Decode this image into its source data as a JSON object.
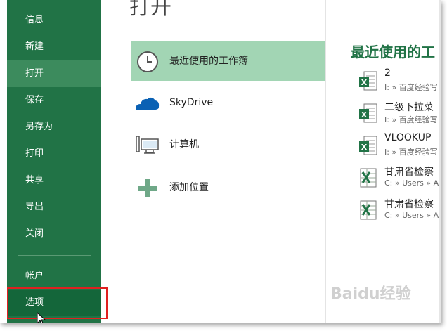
{
  "nav": {
    "items": [
      {
        "label": "信息"
      },
      {
        "label": "新建"
      },
      {
        "label": "打开"
      },
      {
        "label": "保存"
      },
      {
        "label": "另存为"
      },
      {
        "label": "打印"
      },
      {
        "label": "共享"
      },
      {
        "label": "导出"
      },
      {
        "label": "关闭"
      },
      {
        "label": "帐户"
      },
      {
        "label": "选项"
      }
    ]
  },
  "main": {
    "title": "打开",
    "places": [
      {
        "label": "最近使用的工作簿",
        "icon": "clock-icon"
      },
      {
        "label": "SkyDrive",
        "icon": "cloud-icon"
      },
      {
        "label": "计算机",
        "icon": "computer-icon"
      },
      {
        "label": "添加位置",
        "icon": "plus-icon"
      }
    ]
  },
  "recent": {
    "title": "最近使用的工",
    "files": [
      {
        "name": "2",
        "path": "I: » 百度经验写",
        "icon": "excel-file-icon"
      },
      {
        "name": "二级下拉菜",
        "path": "I: » 百度经验写",
        "icon": "excel-file-icon"
      },
      {
        "name": "VLOOKUP",
        "path": "I: » 百度经验写",
        "icon": "excel-file-icon"
      },
      {
        "name": "甘肃省检察",
        "path": "C: » Users » A",
        "icon": "excel-old-file-icon"
      },
      {
        "name": "甘肃省检察",
        "path": "C: » Users » A",
        "icon": "excel-old-file-icon"
      }
    ]
  },
  "watermark": "Baidu经验",
  "colors": {
    "nav_bg": "#217346",
    "nav_active": "#3c8b5d",
    "accent": "#217346",
    "place_active": "#a2d5b4"
  }
}
